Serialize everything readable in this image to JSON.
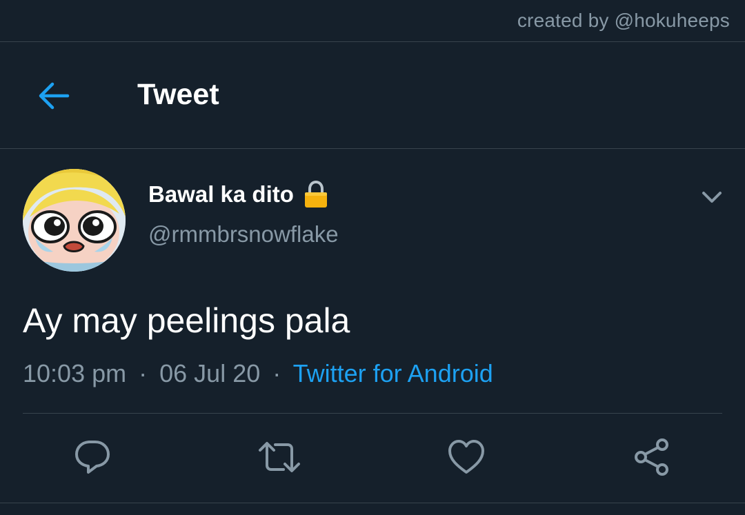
{
  "watermark": "created by @hokuheeps",
  "header": {
    "title": "Tweet",
    "back_icon": "arrow-left-icon"
  },
  "tweet": {
    "author_name": "Bawal ka dito",
    "protected_icon": "lock-icon",
    "handle": "@rmmbrsnowflake",
    "text": "Ay may peelings pala",
    "time": "10:03 pm",
    "date": "06 Jul 20",
    "separator": "·",
    "source": "Twitter for Android",
    "more_icon": "chevron-down-icon"
  },
  "actions": [
    {
      "name": "reply",
      "icon": "reply-icon"
    },
    {
      "name": "retweet",
      "icon": "retweet-icon"
    },
    {
      "name": "like",
      "icon": "heart-icon"
    },
    {
      "name": "share",
      "icon": "share-icon"
    }
  ],
  "colors": {
    "background": "#15202b",
    "divider": "#38444d",
    "secondary_text": "#8899a6",
    "accent": "#1da1f2",
    "primary_text": "#ffffff"
  }
}
